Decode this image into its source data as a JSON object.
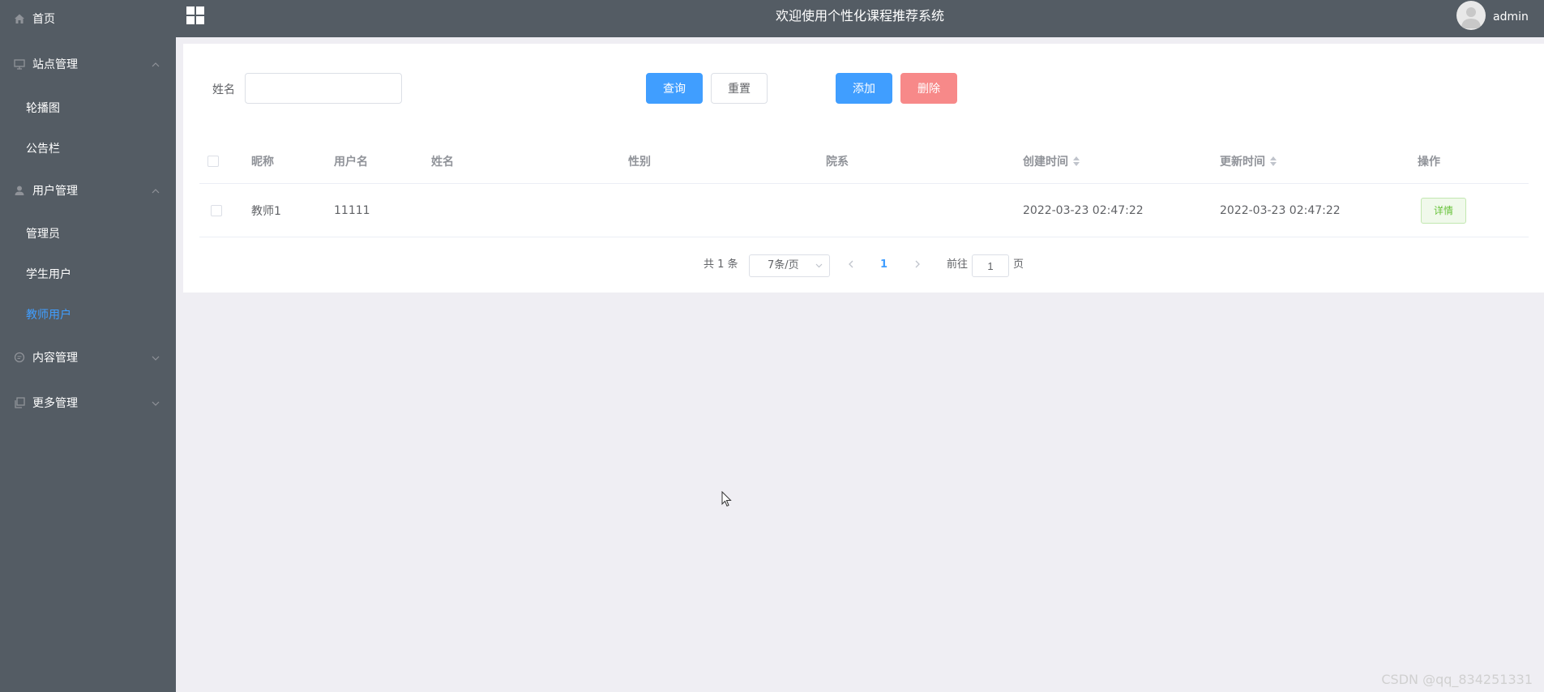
{
  "sidebar": {
    "home": "首页",
    "groups": [
      {
        "label": "站点管理",
        "icon": "monitor-icon",
        "expanded": true,
        "children": [
          "轮播图",
          "公告栏"
        ]
      },
      {
        "label": "用户管理",
        "icon": "user-icon",
        "expanded": true,
        "children": [
          "管理员",
          "学生用户",
          "教师用户"
        ],
        "active": "教师用户"
      },
      {
        "label": "内容管理",
        "icon": "chat-icon",
        "expanded": false,
        "children": []
      },
      {
        "label": "更多管理",
        "icon": "copy-icon",
        "expanded": false,
        "children": []
      }
    ]
  },
  "header": {
    "title": "欢迎使用个性化课程推荐系统",
    "username": "admin"
  },
  "search": {
    "label": "姓名",
    "value": "",
    "query_btn": "查询",
    "reset_btn": "重置",
    "add_btn": "添加",
    "delete_btn": "删除"
  },
  "table": {
    "columns": [
      "昵称",
      "用户名",
      "姓名",
      "性别",
      "院系",
      "创建时间",
      "更新时间",
      "操作"
    ],
    "rows": [
      {
        "nickname": "教师1",
        "username": "11111",
        "name": "",
        "gender": "",
        "dept": "",
        "created": "2022-03-23 02:47:22",
        "updated": "2022-03-23 02:47:22",
        "action": "详情"
      }
    ]
  },
  "pagination": {
    "total": "共 1 条",
    "page_size": "7条/页",
    "current_page": "1",
    "goto_label": "前往",
    "goto_value": "1",
    "goto_suffix": "页"
  },
  "watermark": "CSDN @qq_834251331",
  "colors": {
    "sidebar_bg": "#545c64",
    "accent": "#409eff",
    "danger": "#f78989",
    "success": "#67c23a",
    "page_bg": "#efeef3"
  }
}
